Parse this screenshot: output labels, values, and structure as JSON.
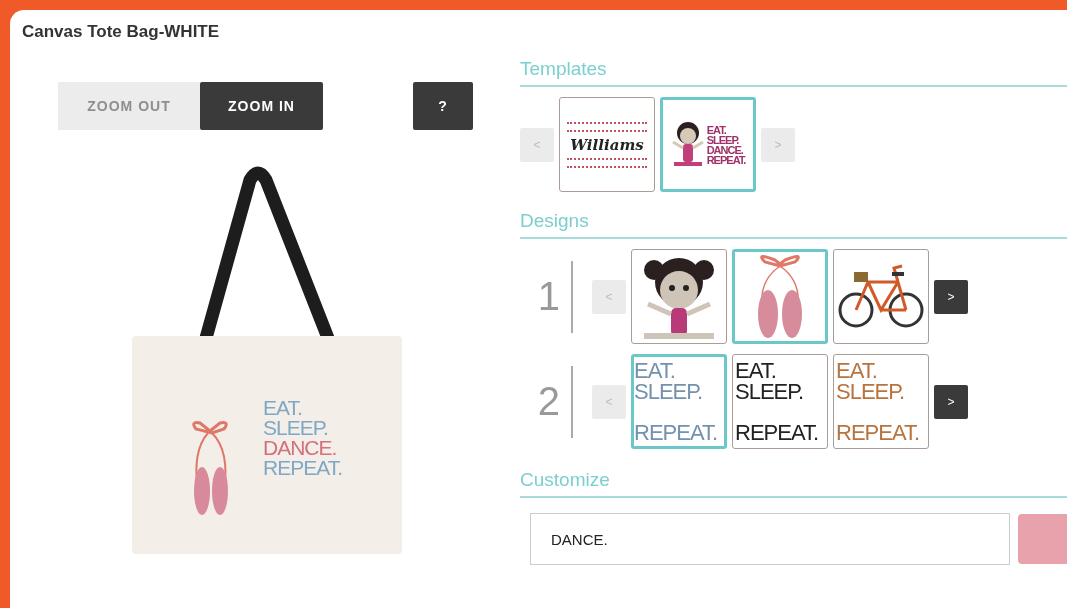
{
  "title": "Canvas Tote Bag-WHITE",
  "zoom_buttons": [
    {
      "label": "ZOOM OUT",
      "active": false
    },
    {
      "label": "ZOOM IN",
      "active": true
    }
  ],
  "help_button": "?",
  "bag_preview": {
    "lines": [
      {
        "text": "EAT.",
        "color": "#7fa8c6"
      },
      {
        "text": "SLEEP.",
        "color": "#7fa8c6"
      },
      {
        "text": "DANCE.",
        "color": "#d4707e"
      },
      {
        "text": "REPEAT.",
        "color": "#7fa8c6"
      }
    ]
  },
  "templates": {
    "heading": "Templates",
    "prev": {
      "label": "<",
      "disabled": true
    },
    "next": {
      "label": ">",
      "disabled": true
    },
    "items": [
      {
        "kind": "name",
        "lines": [
          "Williams"
        ],
        "selected": false
      },
      {
        "kind": "dancer",
        "lines": [
          "EAT.",
          "SLEEP.",
          "DANCE.",
          "REPEAT."
        ],
        "selected": true
      }
    ]
  },
  "designs": {
    "heading": "Designs",
    "rows": [
      {
        "number": "1",
        "prev": {
          "label": "<",
          "disabled": true
        },
        "next": {
          "label": ">",
          "disabled": false
        },
        "items": [
          {
            "kind": "girl",
            "selected": false
          },
          {
            "kind": "shoes",
            "selected": true
          },
          {
            "kind": "bicycle",
            "selected": false
          }
        ]
      },
      {
        "number": "2",
        "prev": {
          "label": "<",
          "disabled": true
        },
        "next": {
          "label": ">",
          "disabled": false
        },
        "items": [
          {
            "kind": "text",
            "color": "#7491ad",
            "lines": [
              "EAT.",
              "SLEEP.",
              "REPEAT."
            ],
            "selected": true
          },
          {
            "kind": "text",
            "color": "#222222",
            "lines": [
              "EAT.",
              "SLEEP.",
              "REPEAT."
            ],
            "selected": false
          },
          {
            "kind": "text",
            "color": "#b8743f",
            "lines": [
              "EAT.",
              "SLEEP.",
              "REPEAT."
            ],
            "selected": false
          }
        ]
      }
    ]
  },
  "customize": {
    "heading": "Customize",
    "value": "DANCE.",
    "color": "#e8a2ab"
  }
}
